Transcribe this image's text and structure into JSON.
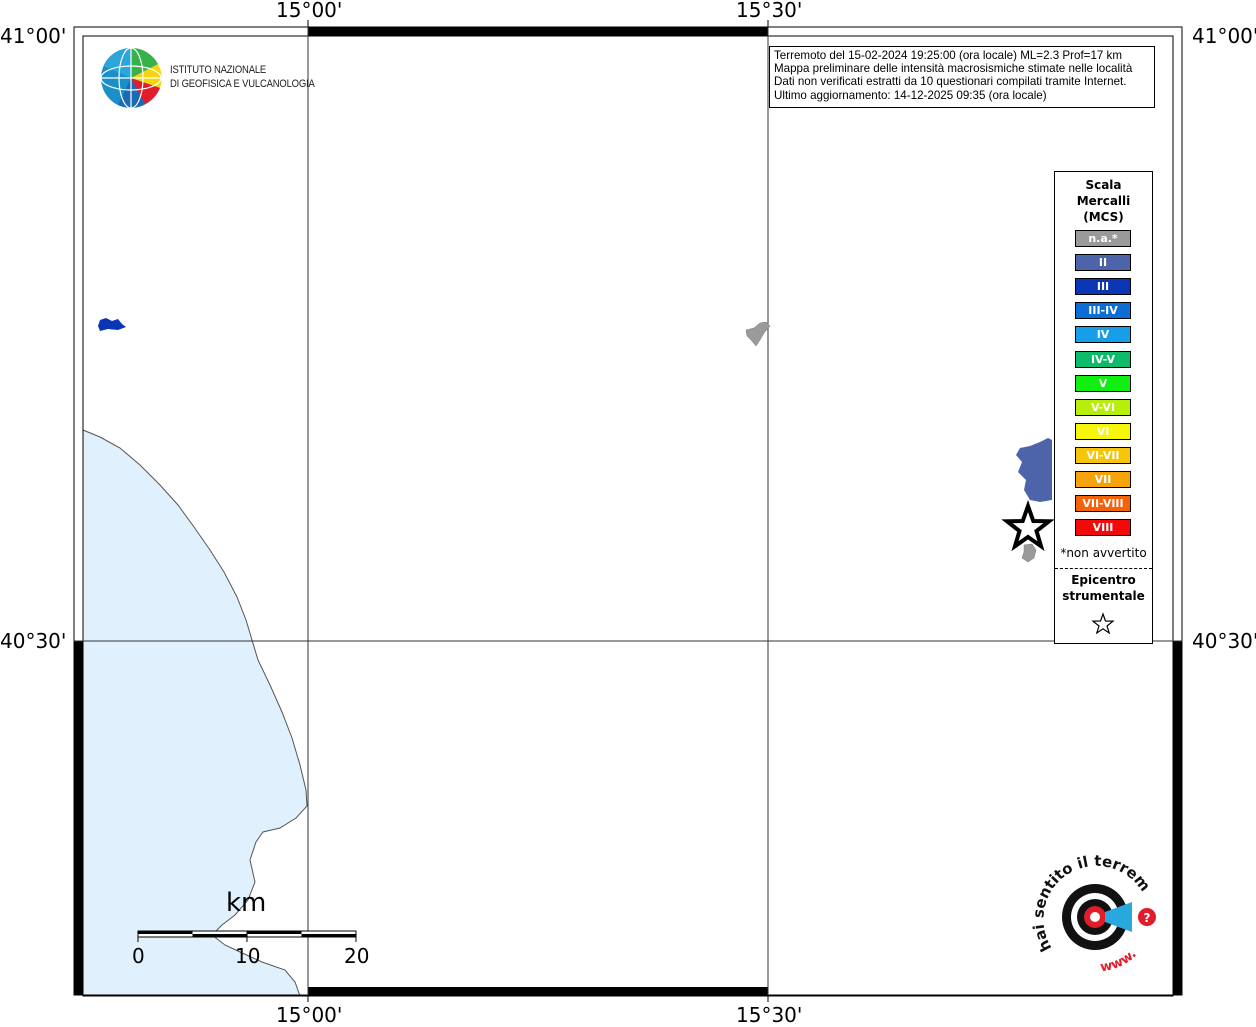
{
  "lat_labels": {
    "top": "41°00'",
    "mid": "40°30'"
  },
  "lon_labels": {
    "left": "15°00'",
    "right": "15°30'"
  },
  "logo": {
    "line1": "ISTITUTO NAZIONALE",
    "line2": "DI GEOFISICA E VULCANOLOGIA"
  },
  "info": {
    "line1": "Terremoto del 15-02-2024 19:25:00 (ora locale) ML=2.3 Prof=17 km",
    "line2": "Mappa preliminare delle intensità macrosismiche stimate nelle località",
    "line3": "Dati non verificati estratti da 10 questionari compilati tramite Internet.",
    "line4": "Ultimo aggiornamento: 14-12-2025 09:35 (ora locale)"
  },
  "legend": {
    "title1": "Scala",
    "title2": "Mercalli",
    "title3": "(MCS)",
    "items": [
      {
        "label": "n.a.*",
        "color": "#9a9a9a"
      },
      {
        "label": "II",
        "color": "#4e64aa"
      },
      {
        "label": "III",
        "color": "#0a35b4"
      },
      {
        "label": "III-IV",
        "color": "#0c6dd6"
      },
      {
        "label": "IV",
        "color": "#169fe8"
      },
      {
        "label": "IV-V",
        "color": "#0dbb6a"
      },
      {
        "label": "V",
        "color": "#11ee11"
      },
      {
        "label": "V-VI",
        "color": "#b8ee0c"
      },
      {
        "label": "VI",
        "color": "#f6f60a"
      },
      {
        "label": "VI-VII",
        "color": "#f6c40a"
      },
      {
        "label": "VII",
        "color": "#f6a20a"
      },
      {
        "label": "VII-VIII",
        "color": "#f6620a"
      },
      {
        "label": "VIII",
        "color": "#f20a0a"
      }
    ],
    "note": "*non avvertito",
    "epi1": "Epicentro",
    "epi2": "strumentale"
  },
  "scale": {
    "unit": "km",
    "ticks": [
      "0",
      "10",
      "20"
    ]
  },
  "hsit_logo": {
    "top_text": "hai sentito il terremoto.it",
    "bottom_text": "www."
  },
  "colors": {
    "sea": "#e0f0fc",
    "intensity_II": "#4e64aa",
    "intensity_III": "#0a35b4",
    "not_available": "#9a9a9a"
  }
}
